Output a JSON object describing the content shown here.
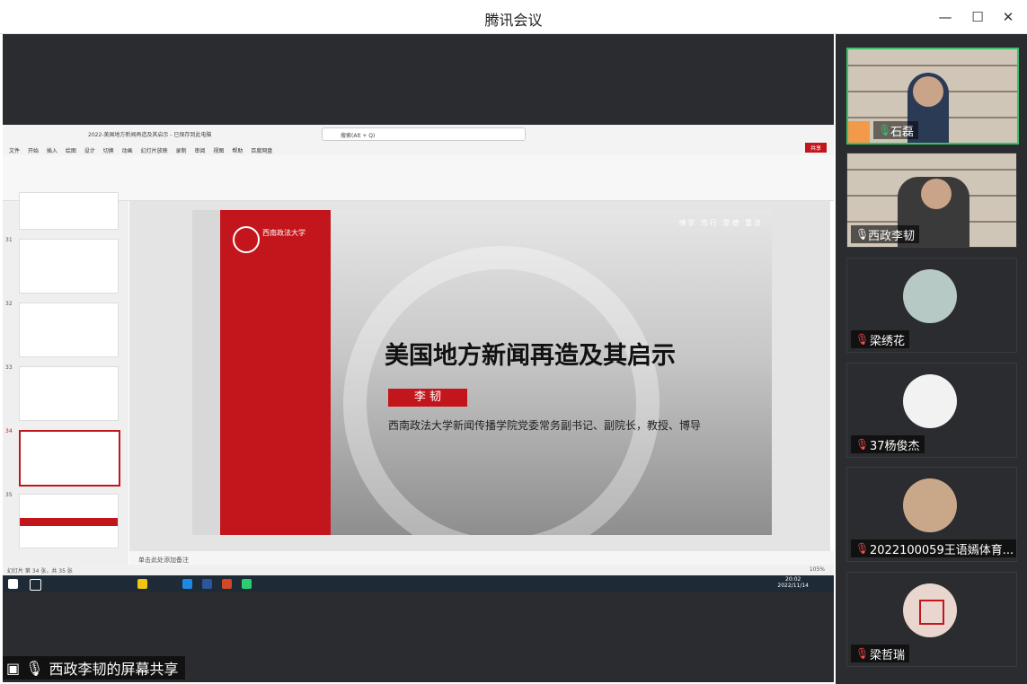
{
  "window": {
    "title": "腾讯会议"
  },
  "share": {
    "label": "西政李韧的屏幕共享"
  },
  "ppt": {
    "filename": "2022-美国地方新闻再造及其启示 - 已保存到此电脑",
    "search": "搜索(Alt + Q)",
    "share_btn": "共享",
    "menu": [
      "文件",
      "开始",
      "插入",
      "绘图",
      "设计",
      "切换",
      "动画",
      "幻灯片放映",
      "录制",
      "审阅",
      "视图",
      "帮助",
      "百度网盘"
    ],
    "notes": "单击此处添加备注",
    "status": "幻灯片 第 34 张，共 35 张",
    "zoom": "105%",
    "thumbs": [
      "31",
      "32",
      "33",
      "34",
      "35"
    ]
  },
  "slide": {
    "title": "美国地方新闻再造及其启示",
    "name": "李 韧",
    "subtitle": "西南政法大学新闻传播学院党委常务副书记、副院长，教授、博导",
    "motto": "博学  笃行  厚德  重法",
    "school": "西南政法大学"
  },
  "taskbar": {
    "time": "20:02",
    "date": "2022/11/14"
  },
  "participants": [
    {
      "name": "石磊",
      "mic": "on",
      "video": true
    },
    {
      "name": "西政李韧",
      "mic": "on",
      "video": true
    },
    {
      "name": "梁绣花",
      "mic": "off",
      "video": false
    },
    {
      "name": "37杨俊杰",
      "mic": "off",
      "video": false
    },
    {
      "name": "2022100059王语嫣体育...",
      "mic": "off",
      "video": false
    },
    {
      "name": "梁哲瑞",
      "mic": "off",
      "video": false
    }
  ]
}
